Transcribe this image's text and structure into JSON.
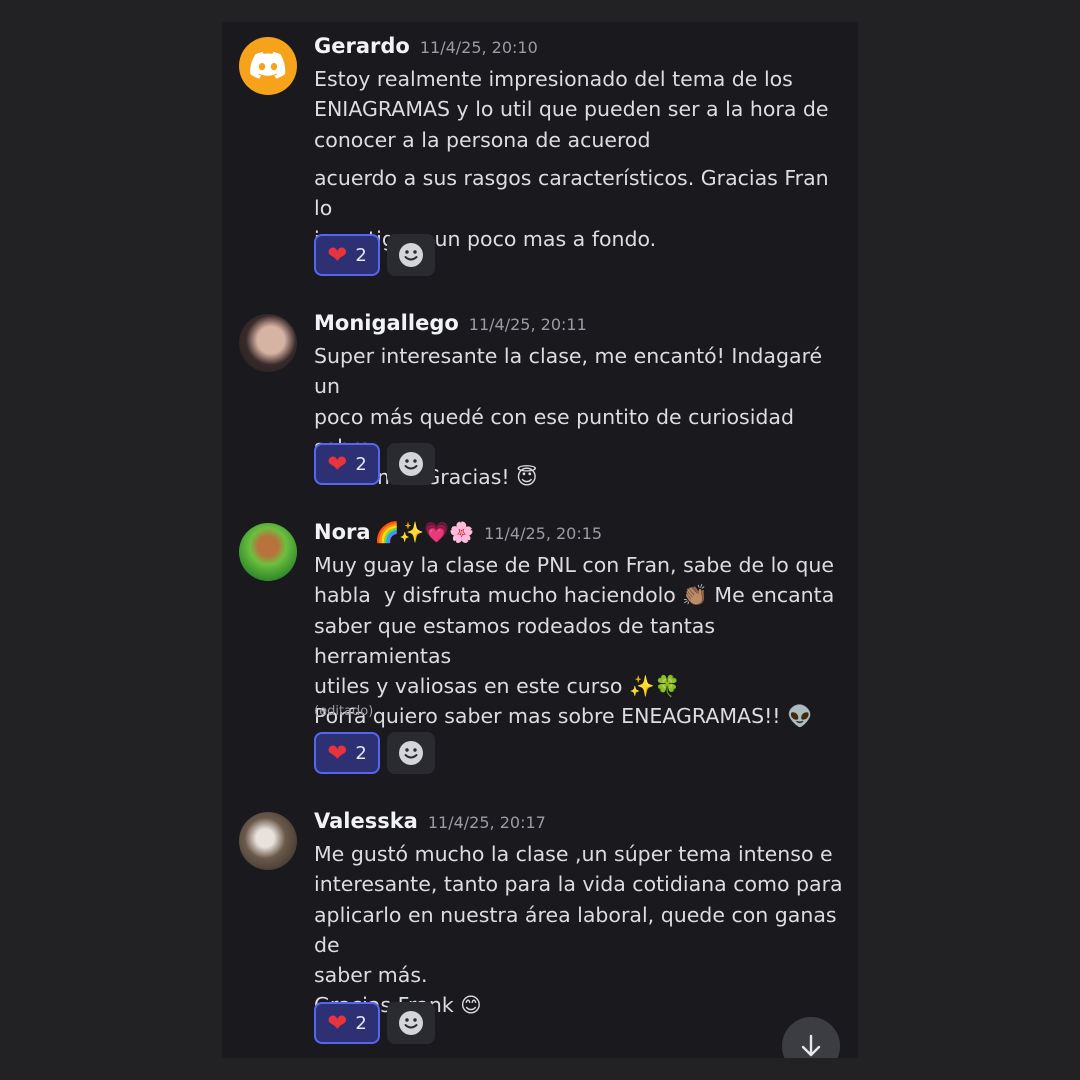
{
  "messages": [
    {
      "username": "Gerardo",
      "time": "11/4/25, 20:10",
      "avatar": "discord-logo-icon",
      "lines": "Estoy realmente impresionado del tema de los\nENIAGRAMAS y lo util que pueden ser a la hora de\nconocer a la persona de acuerod",
      "lines2": "acuerdo a sus rasgos característicos. Gracias Fran lo\ninvestigare un poco mas a fondo.",
      "reaction_emoji": "❤",
      "reaction_count": "2"
    },
    {
      "username": "Monigallego",
      "time": "11/4/25, 20:11",
      "avatar": "user-photo",
      "lines": "Super interesante la clase, me encantó! Indagaré un\npoco más quedé con ese puntito de curiosidad sobre\nese tema! Gracias! 😇",
      "reaction_emoji": "❤",
      "reaction_count": "2"
    },
    {
      "username": "Nora",
      "name_emojis": "🌈✨💗🌸",
      "time": "11/4/25, 20:15",
      "avatar": "dog-photo",
      "lines": "Muy guay la clase de PNL con Fran, sabe de lo que\nhabla  y disfruta mucho haciendolo 👏🏽 Me encanta\nsaber que estamos rodeados de tantas herramientas\nutiles y valiosas en este curso ✨🍀\nPorfa quiero saber mas sobre ENEAGRAMAS!! 👽",
      "edited": "(editado)",
      "reaction_emoji": "❤",
      "reaction_count": "2"
    },
    {
      "username": "Valesska",
      "time": "11/4/25, 20:17",
      "avatar": "couple-photo",
      "lines": "Me gustó mucho la clase ,un súper tema intenso e\ninteresante, tanto para la vida cotidiana como para\naplicarlo en nuestra área laboral, quede con ganas de\nsaber más.\nGracias Frank 😊",
      "reaction_emoji": "❤",
      "reaction_count": "2"
    }
  ],
  "icons": {
    "add_reaction": "smiley-icon",
    "scroll_down": "arrow-down-icon"
  },
  "colors": {
    "background": "#1a1a1e",
    "accent": "#5865f2",
    "discord_avatar": "#f7a21b"
  }
}
